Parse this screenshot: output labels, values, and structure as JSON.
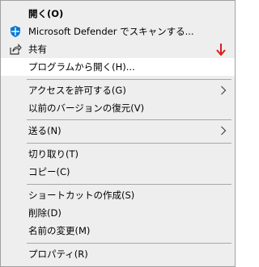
{
  "menu": {
    "items": [
      {
        "label": "開く(O)"
      },
      {
        "label": "Microsoft Defender でスキャンする..."
      },
      {
        "label": "共有"
      },
      {
        "label": "プログラムから開く(H)..."
      },
      {
        "label": "アクセスを許可する(G)"
      },
      {
        "label": "以前のバージョンの復元(V)"
      },
      {
        "label": "送る(N)"
      },
      {
        "label": "切り取り(T)"
      },
      {
        "label": "コピー(C)"
      },
      {
        "label": "ショートカットの作成(S)"
      },
      {
        "label": "削除(D)"
      },
      {
        "label": "名前の変更(M)"
      },
      {
        "label": "プロパティ(R)"
      }
    ]
  },
  "colors": {
    "menu_bg": "#eeeeee",
    "highlight_bg": "#ffffff",
    "arrow": "#d81e1e",
    "defender_blue": "#0078d7"
  },
  "icons": {
    "defender": "shield-icon",
    "share": "share-icon",
    "annotation": "arrow-down-icon",
    "submenu": "chevron-right-icon"
  }
}
